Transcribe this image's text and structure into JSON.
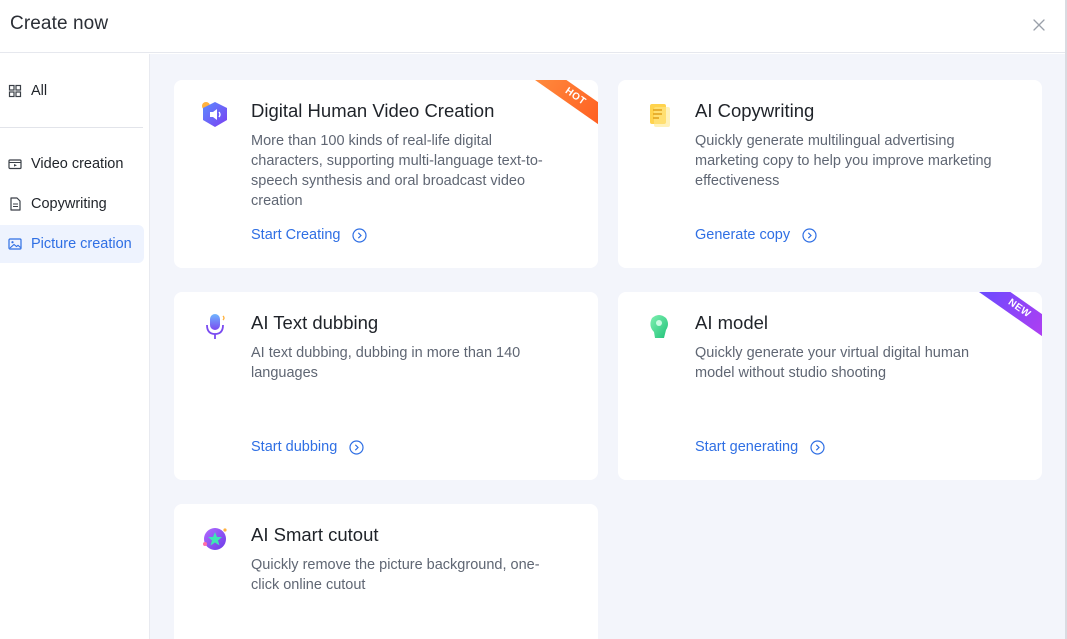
{
  "header": {
    "title": "Create now"
  },
  "sidebar": {
    "items": [
      {
        "label": "All",
        "icon": "grid-icon"
      },
      {
        "label": "Video creation",
        "icon": "video-icon"
      },
      {
        "label": "Copywriting",
        "icon": "document-icon"
      },
      {
        "label": "Picture creation",
        "icon": "image-icon",
        "active": true
      }
    ]
  },
  "cards": [
    {
      "title": "Digital Human Video Creation",
      "desc": "More than 100 kinds of real-life digital characters, supporting multi-language text-to-speech synthesis and oral broadcast video creation",
      "link": "Start Creating",
      "badge": "HOT",
      "icon": "digital-human-icon"
    },
    {
      "title": "AI Copywriting",
      "desc": "Quickly generate multilingual advertising marketing copy to help you improve marketing effectiveness",
      "link": "Generate copy",
      "icon": "copywriting-icon"
    },
    {
      "title": "AI Text dubbing",
      "desc": "AI text dubbing, dubbing in more than 140 languages",
      "link": "Start dubbing",
      "icon": "microphone-icon"
    },
    {
      "title": "AI model",
      "desc": "Quickly generate your virtual digital human model without studio shooting",
      "link": "Start generating",
      "badge": "NEW",
      "icon": "ai-model-icon"
    },
    {
      "title": "AI Smart cutout",
      "desc": "Quickly remove the picture background, one-click online cutout",
      "icon": "cutout-icon"
    }
  ],
  "colors": {
    "accent": "#2f6fe4",
    "active_bg": "#eef3fe",
    "main_bg": "#f3f5fb",
    "hot_badge": "#ff6a2a",
    "new_badge": "#8a45f2"
  }
}
